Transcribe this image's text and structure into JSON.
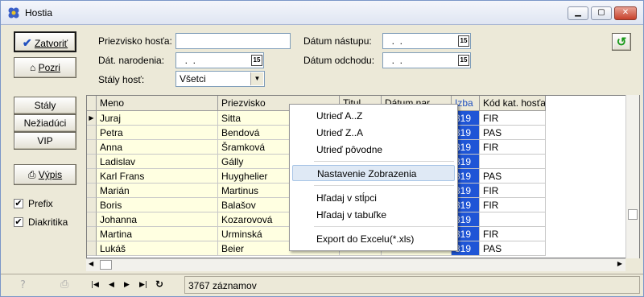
{
  "window": {
    "title": "Hostia"
  },
  "left": {
    "close_label": "Zatvoriť",
    "view_label": "Pozri",
    "tabs": [
      "Stály",
      "Nežiadúci",
      "VIP"
    ],
    "print_label": "Výpis",
    "checks": [
      {
        "label": "Prefix",
        "checked": "✔"
      },
      {
        "label": "Diakritika",
        "checked": "✔"
      }
    ]
  },
  "filters": {
    "surname_label": "Priezvisko hosťa:",
    "surname_value": "",
    "birth_label": "Dát. narodenia:",
    "birth_value": "  .  .",
    "regular_label": "Stály hosť:",
    "regular_value": "Všetci",
    "arrival_label": "Dátum nástupu:",
    "arrival_value": "  .  .",
    "departure_label": "Dátum odchodu:",
    "departure_value": "  .  .",
    "cal_icon": "15"
  },
  "grid": {
    "headers": [
      "Meno",
      "Priezvisko",
      "Titul",
      "Dátum nar.",
      "Izba",
      "Kód kat. hosťa"
    ],
    "rows": [
      [
        "Juraj",
        "Sitta",
        "",
        "",
        "319",
        "FIR"
      ],
      [
        "Petra",
        "Bendová",
        "",
        "",
        "319",
        "PAS"
      ],
      [
        "Anna",
        "Šramková",
        "",
        "",
        "319",
        "FIR"
      ],
      [
        "Ladislav",
        "Gálly",
        "",
        "",
        "319",
        ""
      ],
      [
        "Karl Frans",
        "Huyghelier",
        "",
        "",
        "319",
        "PAS"
      ],
      [
        "Marián",
        "Martinus",
        "",
        "",
        "319",
        "FIR"
      ],
      [
        "Boris",
        "Balašov",
        "",
        "",
        "319",
        "FIR"
      ],
      [
        "Johanna",
        "Kozarovová",
        "",
        "",
        "319",
        ""
      ],
      [
        "Martina",
        "Urminská",
        "",
        "",
        "319",
        "FIR"
      ],
      [
        "Lukáš",
        "Beier",
        "",
        "",
        "319",
        "PAS"
      ]
    ]
  },
  "context_menu": {
    "items": [
      "Utrieď A..Z",
      "Utrieď Z..A",
      "Utrieď pôvodne",
      "Nastavenie Zobrazenia",
      "Hľadaj v stĺpci",
      "Hľadaj v tabuľke",
      "Export do Excelu(*.xls)"
    ]
  },
  "status": {
    "count": "3767 záznamov"
  }
}
